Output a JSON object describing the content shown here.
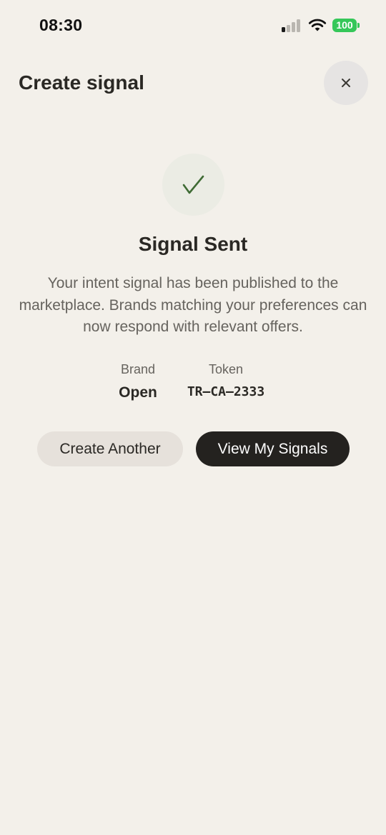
{
  "status_bar": {
    "time": "08:30",
    "battery": "100",
    "icons": [
      "cellular-signal-icon",
      "wifi-icon",
      "battery-icon"
    ]
  },
  "header": {
    "title": "Create signal",
    "close_icon": "close-icon"
  },
  "success": {
    "icon": "checkmark-icon",
    "title": "Signal Sent",
    "description": "Your intent signal has been published to the marketplace. Brands matching your preferences can now respond with relevant offers."
  },
  "details": {
    "brand_label": "Brand",
    "brand_value": "Open",
    "token_label": "Token",
    "token_value": "TR–CA–2333"
  },
  "actions": {
    "create_another": "Create Another",
    "view_signals": "View My Signals"
  },
  "colors": {
    "background": "#f3f0ea",
    "primary_button": "#24221f",
    "secondary_button": "#e6e1db",
    "check_green": "#3f6b34",
    "battery_green": "#35c759"
  }
}
